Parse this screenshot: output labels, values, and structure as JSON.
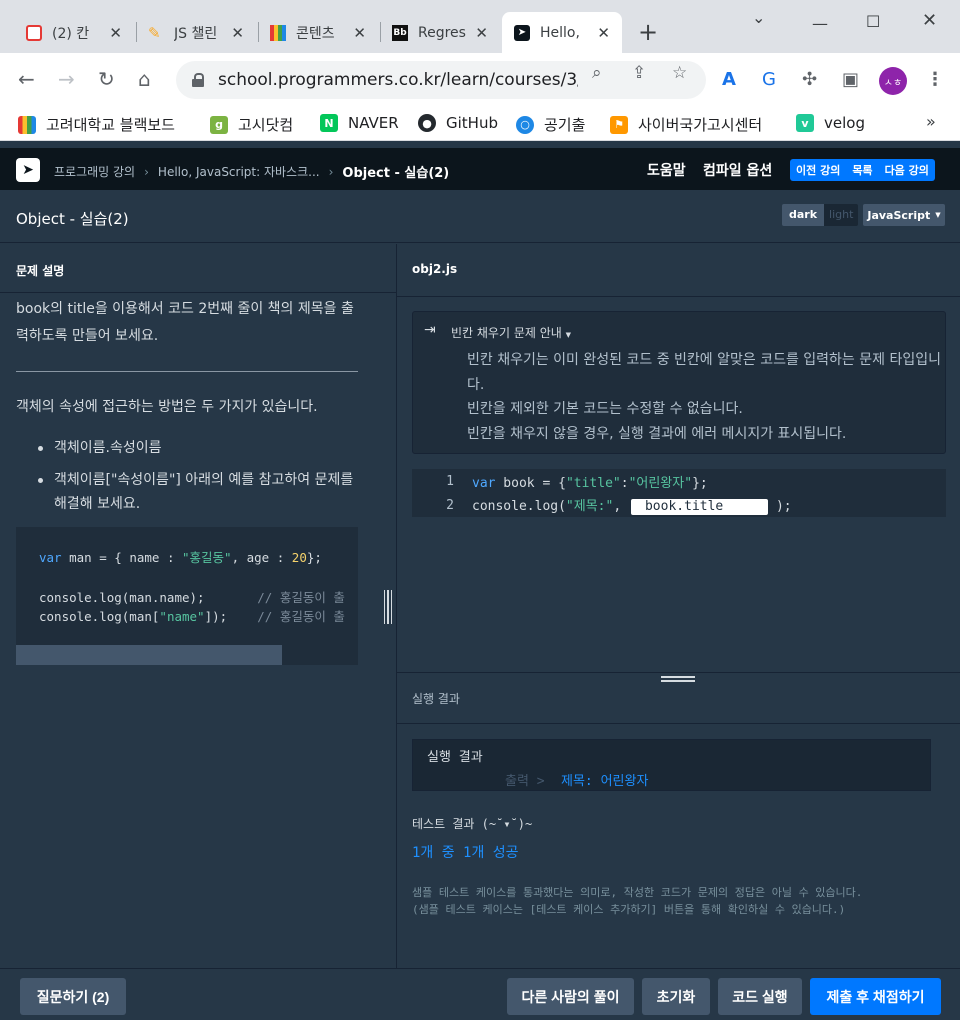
{
  "browser": {
    "tabs": [
      {
        "title": "(2) 칸",
        "icon": "calendar-icon"
      },
      {
        "title": "JS 챌린",
        "icon": "pencil-icon"
      },
      {
        "title": "콘텐츠",
        "icon": "bar-chart-icon"
      },
      {
        "title": "Regres",
        "icon": "blackboard-icon"
      },
      {
        "title": "Hello,",
        "icon": "programmers-icon"
      }
    ],
    "new_tab": "+",
    "url": "school.programmers.co.kr/learn/courses/3/l...",
    "avatar": "ㅅㅎ",
    "bookmarks": [
      {
        "label": "고려대학교 블랙보드",
        "color": "#e53935"
      },
      {
        "label": "고시닷컴",
        "color": "#7cb342"
      },
      {
        "label": "NAVER",
        "color": "#03c75a"
      },
      {
        "label": "GitHub",
        "color": "#24292e"
      },
      {
        "label": "공기출",
        "color": "#1e88e5"
      },
      {
        "label": "사이버국가고시센터",
        "color": "#ff9800"
      },
      {
        "label": "velog",
        "color": "#20c997"
      }
    ],
    "more": "»"
  },
  "app": {
    "crumbs": [
      "프로그래밍 강의",
      "Hello, JavaScript: 자바스크...",
      "Object - 실습(2)"
    ],
    "help": "도움말",
    "compile_options": "컴파일 옵션",
    "nav": {
      "prev": "이전 강의",
      "list": "목록",
      "next": "다음 강의"
    },
    "lesson_title": "Object - 실습(2)",
    "theme": {
      "dark": "dark",
      "light": "light"
    },
    "language": "JavaScript"
  },
  "problem": {
    "heading": "문제 설명",
    "desc": "book의 title을 이용해서 코드 2번째 줄이 책의 제목을 출력하도록 만들어 보세요.",
    "desc2": "객체의 속성에 접근하는 방법은 두 가지가 있습니다.",
    "bullets": [
      "객체이름.속성이름",
      "객체이름[\"속성이름\"] 아래의 예를 참고하여 문제를 해결해 보세요."
    ]
  },
  "editor": {
    "filename": "obj2.js",
    "notice_title": "빈칸 채우기 문제 안내",
    "notice_body": [
      "빈칸 채우기는 이미 완성된 코드 중 빈칸에 알맞은 코드를 입력하는 문제 타입입니다.",
      "빈칸을 제외한 기본 코드는 수정할 수 없습니다.",
      "빈칸을 채우지 않을 경우, 실행 결과에 에러 메시지가 표시됩니다."
    ],
    "line_numbers": [
      "1",
      "2"
    ],
    "blank_value": "book.title"
  },
  "result": {
    "label": "실행 결과",
    "box_title": "실행 결과",
    "output_label": "출력 >",
    "output_value": "제목: 어린왕자",
    "test_head": "테스트 결과 (~˘▾˘)~",
    "test_result": "1개 중 1개 성공",
    "test_note": "샘플 테스트 케이스를 통과했다는 의미로, 작성한 코드가 문제의 정답은 아닐 수 있습니다.\n(샘플 테스트 케이스는 [테스트 케이스 추가하기] 버튼을 통해 확인하실 수 있습니다.)"
  },
  "footer": {
    "ask": "질문하기 (2)",
    "others": "다른 사람의 풀이",
    "reset": "초기화",
    "run": "코드 실행",
    "submit": "제출 후 채점하기"
  },
  "colors": {
    "accent": "#0078ff",
    "panel": "#263747",
    "header": "#0c151c"
  }
}
